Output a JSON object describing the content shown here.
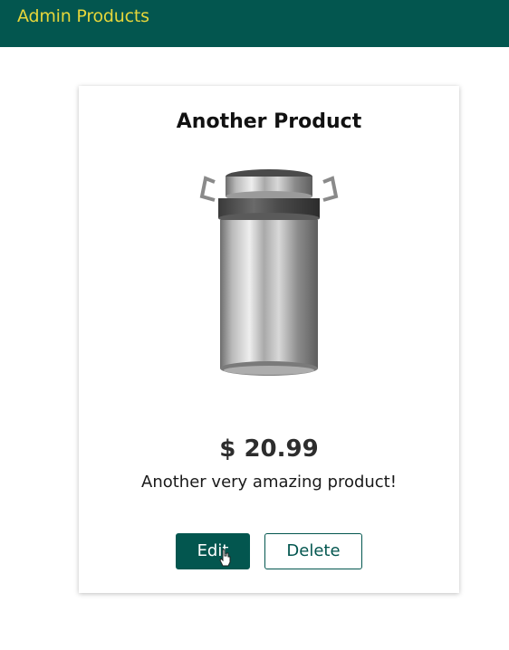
{
  "header": {
    "nav_label": "Admin Products"
  },
  "product": {
    "title": "Another Product",
    "price": "$ 20.99",
    "description": "Another very amazing product!",
    "image_icon": "milk-can-image"
  },
  "actions": {
    "edit_label": "Edit",
    "delete_label": "Delete"
  },
  "colors": {
    "header_bg": "#03564f",
    "header_link": "#e6d63a",
    "accent": "#03564f"
  }
}
